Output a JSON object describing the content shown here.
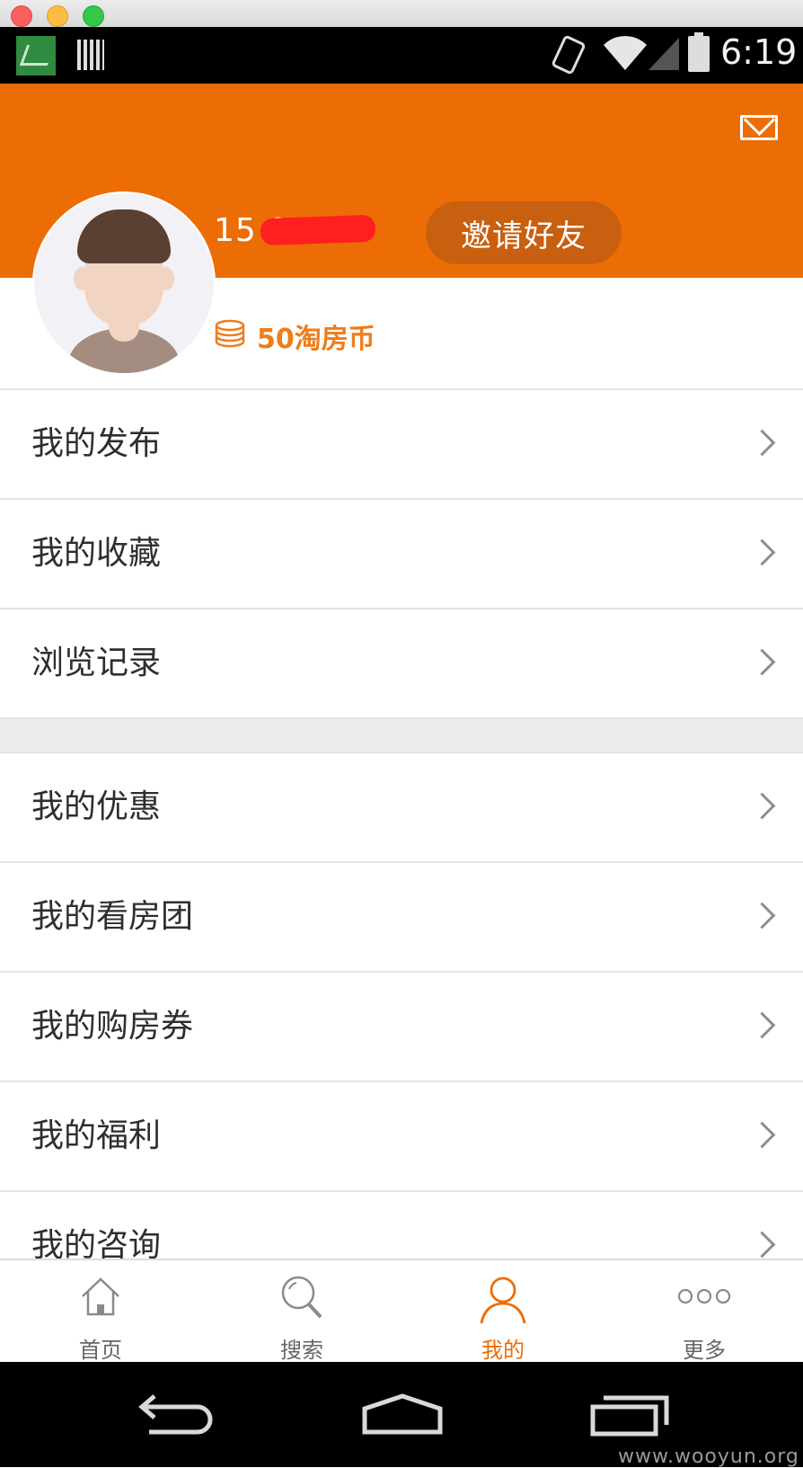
{
  "status_bar": {
    "time": "6:19"
  },
  "profile": {
    "phone_display": "15 0",
    "invite_label": "邀请好友",
    "coins_label": "50淘房币"
  },
  "menu": {
    "group1": [
      {
        "label": "我的发布"
      },
      {
        "label": "我的收藏"
      },
      {
        "label": "浏览记录"
      }
    ],
    "group2": [
      {
        "label": "我的优惠"
      },
      {
        "label": "我的看房团"
      },
      {
        "label": "我的购房券"
      },
      {
        "label": "我的福利"
      },
      {
        "label": "我的咨询"
      }
    ]
  },
  "bottom_nav": {
    "items": [
      {
        "label": "首页",
        "icon": "home-icon"
      },
      {
        "label": "搜索",
        "icon": "search-icon"
      },
      {
        "label": "我的",
        "icon": "person-icon",
        "active": true
      },
      {
        "label": "更多",
        "icon": "more-dots-icon"
      }
    ]
  },
  "watermark": "www.wooyun.org",
  "colors": {
    "accent": "#ec6d05",
    "invite_button": "#c8600f",
    "coins_text": "#ef7c1d"
  }
}
